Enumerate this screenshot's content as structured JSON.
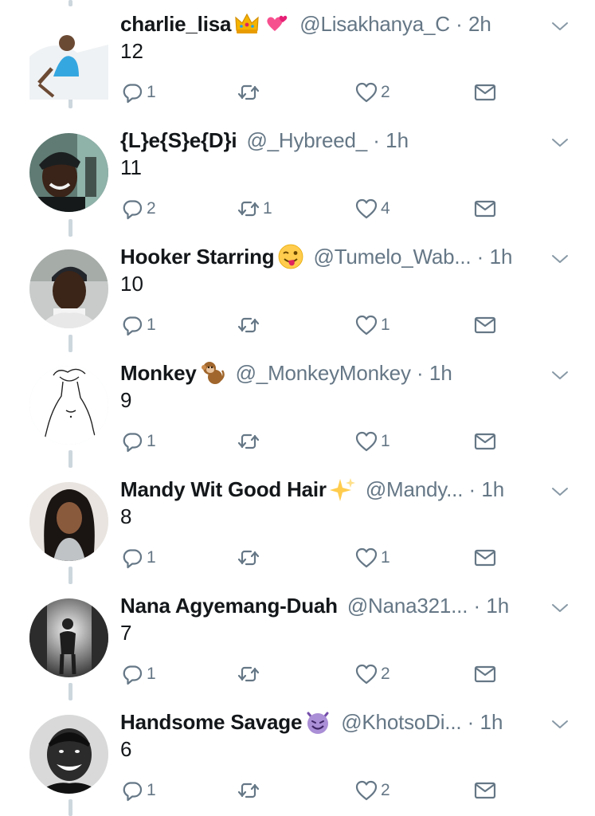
{
  "icons": {
    "reply": "reply-icon",
    "retweet": "retweet-icon",
    "like": "heart-icon",
    "dm": "envelope-icon",
    "more": "chevron-down-icon"
  },
  "colors": {
    "muted": "#657786",
    "text": "#14171a",
    "thread_line": "#ccd6dd"
  },
  "tweets": [
    {
      "name": "charlie_lisa",
      "emojis": [
        "crown",
        "two-hearts"
      ],
      "handle": "@Lisakhanya_C",
      "time": "2h",
      "text": "12",
      "replies": "1",
      "retweets": "",
      "likes": "2"
    },
    {
      "name": "{L}e{S}e{D}i",
      "emojis": [],
      "handle": "@_Hybreed_",
      "time": "1h",
      "text": "11",
      "replies": "2",
      "retweets": "1",
      "likes": "4"
    },
    {
      "name": "Hooker Starring",
      "emojis": [
        "winking-tongue-face"
      ],
      "handle": "@Tumelo_Wab...",
      "time": "1h",
      "text": "10",
      "replies": "1",
      "retweets": "",
      "likes": "1"
    },
    {
      "name": "Monkey",
      "emojis": [
        "monkey"
      ],
      "handle": "@_MonkeyMonkey",
      "time": "1h",
      "text": "9",
      "replies": "1",
      "retweets": "",
      "likes": "1"
    },
    {
      "name": "Mandy Wit Good Hair",
      "emojis": [
        "sparkles"
      ],
      "handle": "@Mandy...",
      "time": "1h",
      "text": "8",
      "replies": "1",
      "retweets": "",
      "likes": "1"
    },
    {
      "name": "Nana Agyemang-Duah",
      "emojis": [],
      "handle": "@Nana321...",
      "time": "1h",
      "text": "7",
      "replies": "1",
      "retweets": "",
      "likes": "2"
    },
    {
      "name": "Handsome Savage",
      "emojis": [
        "smiling-imp"
      ],
      "handle": "@KhotsoDi...",
      "time": "1h",
      "text": "6",
      "replies": "1",
      "retweets": "",
      "likes": "2"
    }
  ]
}
